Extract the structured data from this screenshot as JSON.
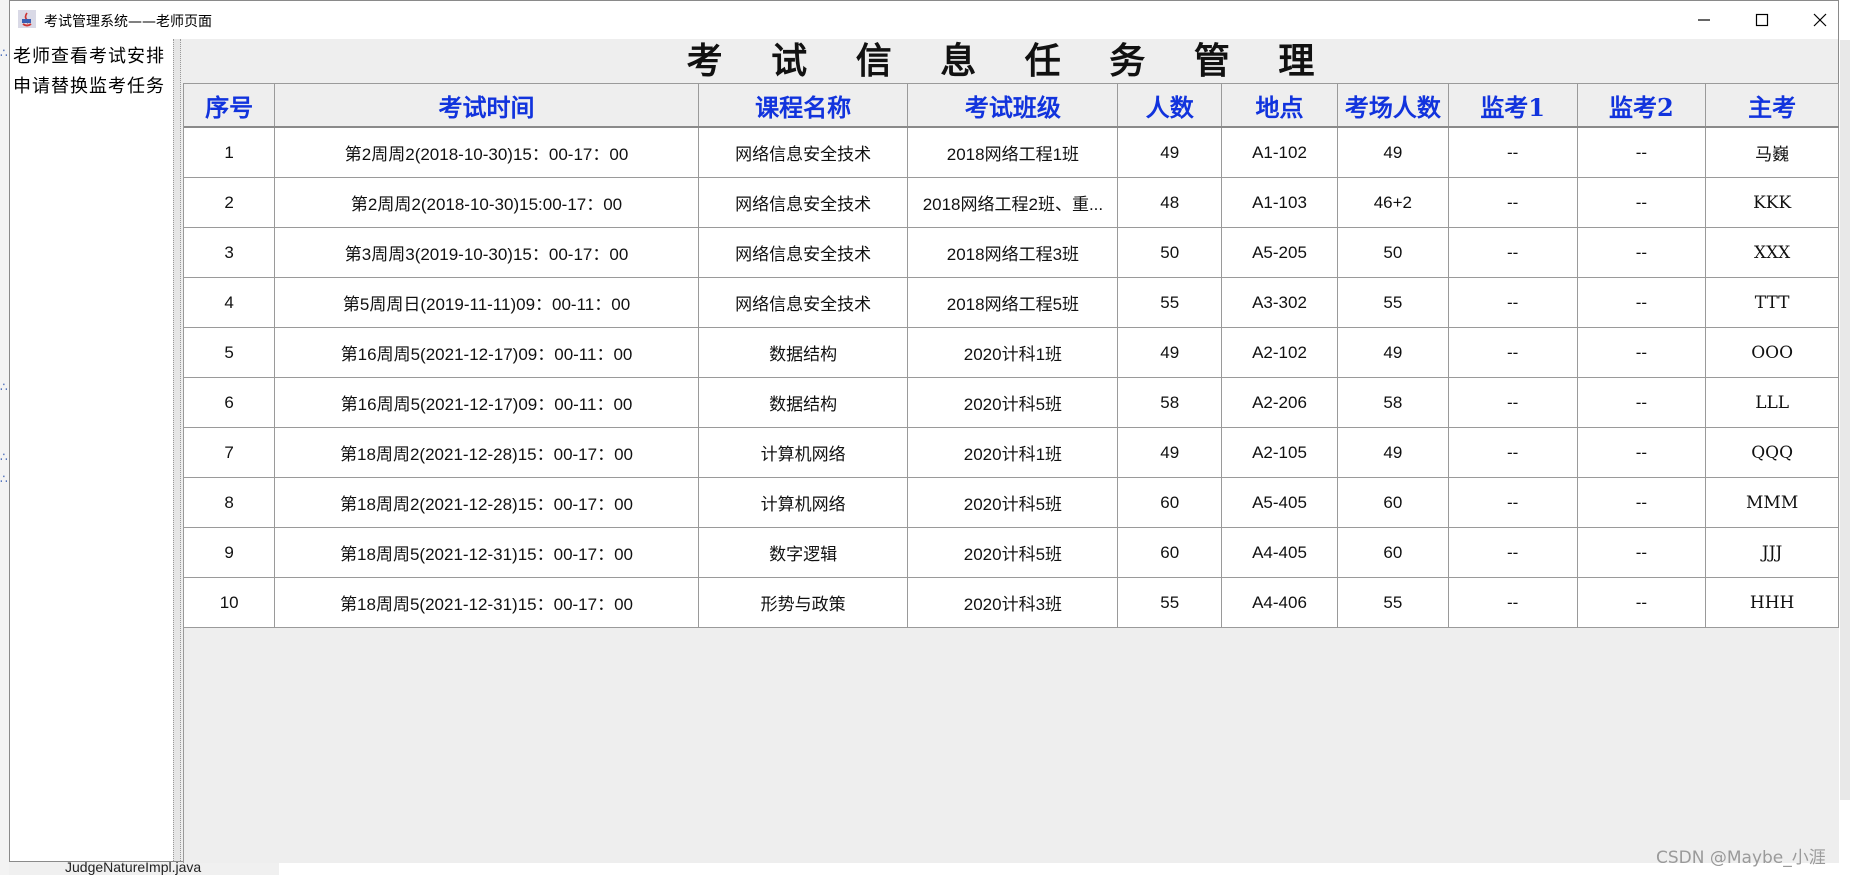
{
  "window": {
    "title": "考试管理系统——老师页面"
  },
  "sidebar": {
    "items": [
      {
        "label": "老师查看考试安排"
      },
      {
        "label": "申请替换监考任务"
      }
    ]
  },
  "main": {
    "title": "考 试 信 息 任 务 管 理"
  },
  "table": {
    "columns": [
      "序号",
      "考试时间",
      "课程名称",
      "考试班级",
      "人数",
      "地点",
      "考场人数",
      "监考1",
      "监考2",
      "主考"
    ],
    "rows": [
      [
        "1",
        "第2周周2(2018-10-30)15：00-17：00",
        "网络信息安全技术",
        "2018网络工程1班",
        "49",
        "A1-102",
        "49",
        "--",
        "--",
        "马巍"
      ],
      [
        "2",
        "第2周周2(2018-10-30)15:00-17：00",
        "网络信息安全技术",
        "2018网络工程2班、重...",
        "48",
        "A1-103",
        "46+2",
        "--",
        "--",
        "KKK"
      ],
      [
        "3",
        "第3周周3(2019-10-30)15：00-17：00",
        "网络信息安全技术",
        "2018网络工程3班",
        "50",
        "A5-205",
        "50",
        "--",
        "--",
        "XXX"
      ],
      [
        "4",
        "第5周周日(2019-11-11)09：00-11：00",
        "网络信息安全技术",
        "2018网络工程5班",
        "55",
        "A3-302",
        "55",
        "--",
        "--",
        "TTT"
      ],
      [
        "5",
        "第16周周5(2021-12-17)09：00-11：00",
        "数据结构",
        "2020计科1班",
        "49",
        "A2-102",
        "49",
        "--",
        "--",
        "OOO"
      ],
      [
        "6",
        "第16周周5(2021-12-17)09：00-11：00",
        "数据结构",
        "2020计科5班",
        "58",
        "A2-206",
        "58",
        "--",
        "--",
        "LLL"
      ],
      [
        "7",
        "第18周周2(2021-12-28)15：00-17：00",
        "计算机网络",
        "2020计科1班",
        "49",
        "A2-105",
        "49",
        "--",
        "--",
        "QQQ"
      ],
      [
        "8",
        "第18周周2(2021-12-28)15：00-17：00",
        "计算机网络",
        "2020计科5班",
        "60",
        "A5-405",
        "60",
        "--",
        "--",
        "MMM"
      ],
      [
        "9",
        "第18周周5(2021-12-31)15：00-17：00",
        "数字逻辑",
        "2020计科5班",
        "60",
        "A4-405",
        "60",
        "--",
        "--",
        "JJJ"
      ],
      [
        "10",
        "第18周周5(2021-12-31)15：00-17：00",
        "形势与政策",
        "2020计科3班",
        "55",
        "A4-406",
        "55",
        "--",
        "--",
        "HHH"
      ]
    ]
  },
  "background": {
    "file_label": "JudgeNatureImpl.java"
  },
  "watermark": "CSDN @Maybe_小涯",
  "icons": {
    "app": "java-app-icon",
    "minimize": "minimize-icon",
    "maximize": "maximize-icon",
    "close": "close-icon"
  },
  "colors": {
    "header_text": "#1133dd",
    "cell_bg": "#ffffff",
    "panel_bg": "#eeeeee"
  }
}
